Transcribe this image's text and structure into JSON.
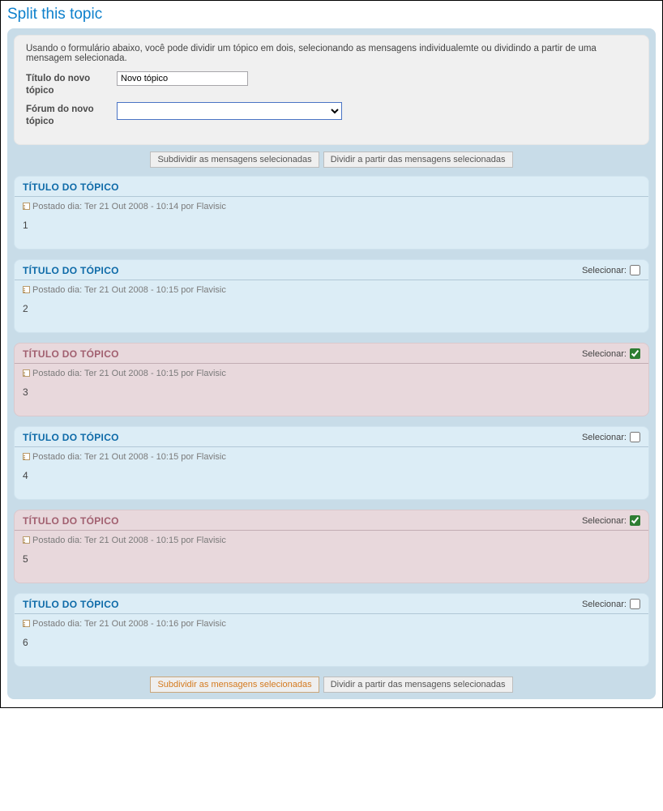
{
  "page": {
    "title": "Split this topic"
  },
  "form": {
    "description": "Usando o formulário abaixo, você pode dividir um tópico em dois, selecionando as mensagens individualemte ou dividindo a partir de uma mensagem selecionada.",
    "title_label": "Título do novo tópico",
    "title_value": "Novo tópico",
    "forum_label": "Fórum do novo tópico",
    "forum_value": ""
  },
  "buttons": {
    "split_selected": "Subdividir as mensagens selecionadas",
    "split_from": "Dividir a partir das mensagens selecionadas"
  },
  "labels": {
    "select": "Selecionar:"
  },
  "posts": [
    {
      "title": "TÍTULO DO TÓPICO",
      "meta": "Postado dia: Ter 21 Out 2008 - 10:14 por Flavisic",
      "body": "1",
      "selectable": false,
      "selected": false
    },
    {
      "title": "TÍTULO DO TÓPICO",
      "meta": "Postado dia: Ter 21 Out 2008 - 10:15 por Flavisic",
      "body": "2",
      "selectable": true,
      "selected": false
    },
    {
      "title": "TÍTULO DO TÓPICO",
      "meta": "Postado dia: Ter 21 Out 2008 - 10:15 por Flavisic",
      "body": "3",
      "selectable": true,
      "selected": true
    },
    {
      "title": "TÍTULO DO TÓPICO",
      "meta": "Postado dia: Ter 21 Out 2008 - 10:15 por Flavisic",
      "body": "4",
      "selectable": true,
      "selected": false
    },
    {
      "title": "TÍTULO DO TÓPICO",
      "meta": "Postado dia: Ter 21 Out 2008 - 10:15 por Flavisic",
      "body": "5",
      "selectable": true,
      "selected": true
    },
    {
      "title": "TÍTULO DO TÓPICO",
      "meta": "Postado dia: Ter 21 Out 2008 - 10:16 por Flavisic",
      "body": "6",
      "selectable": true,
      "selected": false
    }
  ]
}
